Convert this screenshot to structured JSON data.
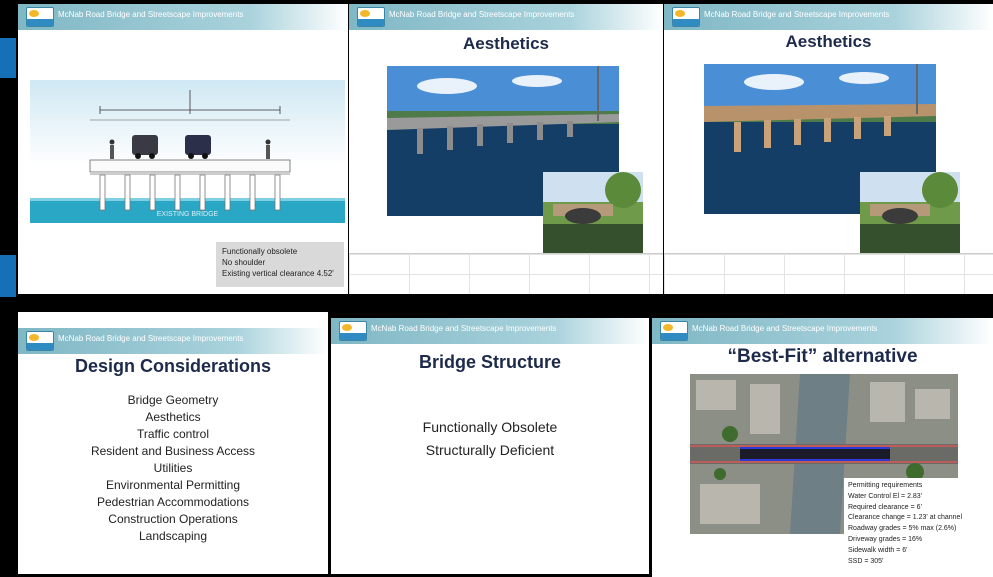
{
  "header_text": "McNab Road Bridge and Streetscape Improvements",
  "logo_text": "pompano beach",
  "slides": {
    "s1": {
      "section_label": "EXISTING BRIDGE",
      "note_lines": [
        "Functionally obsolete",
        "No shoulder",
        "Existing vertical clearance 4.52'"
      ]
    },
    "s2": {
      "title": "Aesthetics"
    },
    "s3": {
      "title": "Aesthetics"
    },
    "s4": {
      "title": "Design Considerations",
      "items": [
        "Bridge Geometry",
        "Aesthetics",
        "Traffic control",
        "Resident and Business Access",
        "Utilities",
        "Environmental Permitting",
        "Pedestrian Accommodations",
        "Construction Operations",
        "Landscaping"
      ]
    },
    "s5": {
      "title": "Bridge Structure",
      "lines": [
        "Functionally Obsolete",
        "Structurally Deficient"
      ]
    },
    "s6": {
      "title": "“Best-Fit” alternative",
      "note_lines": [
        "Permitting requirements",
        "Water Control El = 2.83'",
        "Required clearance = 6'",
        "Clearance change = 1.23' at channel",
        "Roadway grades = 5% max  (2.6%)",
        "Driveway grades = 16%",
        "Sidewalk width = 6'",
        "SSD = 305'"
      ]
    }
  },
  "colors": {
    "header": "#7fb7c4",
    "title": "#1e2a4a",
    "accent_bar": "#1570b8"
  }
}
